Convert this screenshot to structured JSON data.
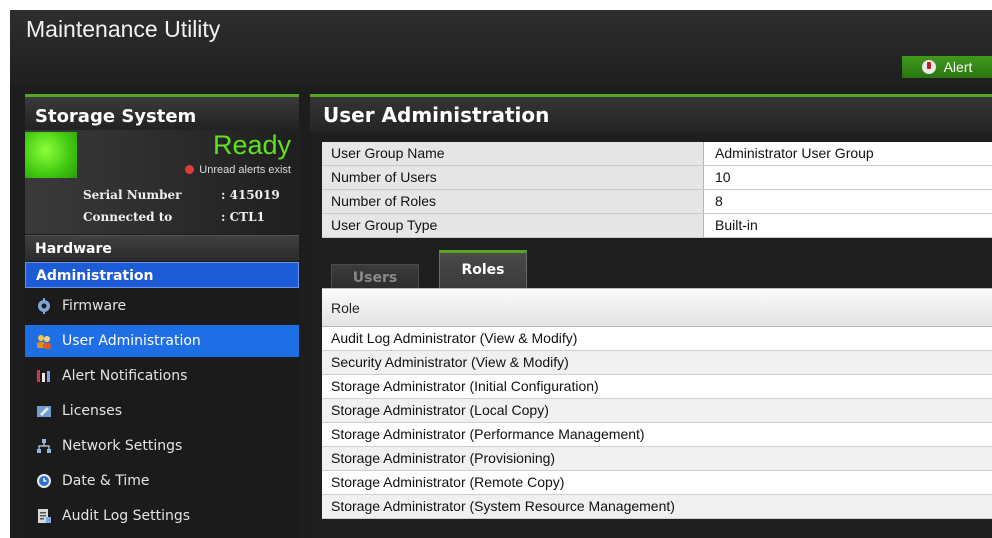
{
  "app": {
    "title": "Maintenance Utility",
    "alert_label": "Alert"
  },
  "sidebar": {
    "title": "Storage System",
    "status": "Ready",
    "unread": "Unread alerts exist",
    "serial_label": "Serial Number",
    "serial_value": ": 415019",
    "connected_label": "Connected to",
    "connected_value": ": CTL1",
    "sections": {
      "hardware": "Hardware",
      "administration": "Administration"
    },
    "items": [
      {
        "label": "Firmware",
        "icon": "firmware-icon"
      },
      {
        "label": "User Administration",
        "icon": "users-icon"
      },
      {
        "label": "Alert Notifications",
        "icon": "alert-notifications-icon"
      },
      {
        "label": "Licenses",
        "icon": "license-icon"
      },
      {
        "label": "Network Settings",
        "icon": "network-icon"
      },
      {
        "label": "Date & Time",
        "icon": "clock-icon"
      },
      {
        "label": "Audit Log Settings",
        "icon": "audit-log-icon"
      }
    ],
    "active_item": "User Administration"
  },
  "main": {
    "title": "User Administration",
    "info": [
      {
        "key": "User Group Name",
        "value": "Administrator User Group"
      },
      {
        "key": "Number of Users",
        "value": "10"
      },
      {
        "key": "Number of Roles",
        "value": "8"
      },
      {
        "key": "User Group Type",
        "value": "Built-in"
      }
    ],
    "tabs": [
      {
        "label": "Users"
      },
      {
        "label": "Roles"
      }
    ],
    "active_tab": "Roles",
    "roles_header": "Role",
    "roles": [
      "Audit Log Administrator (View & Modify)",
      "Security Administrator (View & Modify)",
      "Storage Administrator (Initial Configuration)",
      "Storage Administrator (Local Copy)",
      "Storage Administrator (Performance Management)",
      "Storage Administrator (Provisioning)",
      "Storage Administrator (Remote Copy)",
      "Storage Administrator (System Resource Management)"
    ]
  },
  "colors": {
    "accent_green": "#56a41f",
    "ready_green": "#5fe21f",
    "nav_active": "#1e6ee6",
    "section_blue": "#1e5bd6"
  }
}
